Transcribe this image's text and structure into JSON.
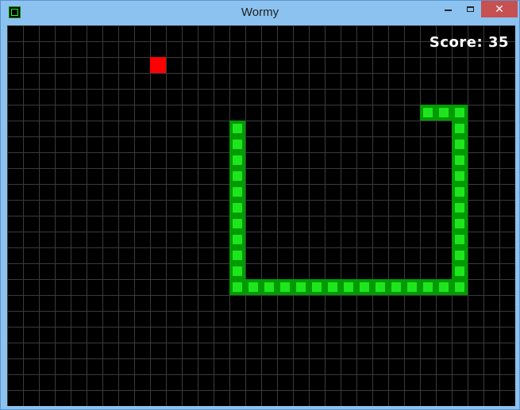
{
  "window": {
    "title": "Wormy",
    "icon": "wormy-app-icon",
    "controls": {
      "minimize": "minimize-icon",
      "maximize": "maximize-icon",
      "close_label": "✕"
    }
  },
  "game": {
    "score_text": "Score: 35",
    "grid": {
      "cols": 32,
      "rows": 24
    },
    "apple": {
      "col": 9,
      "row": 2
    },
    "worm": [
      [
        26,
        5
      ],
      [
        27,
        5
      ],
      [
        28,
        5
      ],
      [
        28,
        6
      ],
      [
        28,
        7
      ],
      [
        28,
        8
      ],
      [
        28,
        9
      ],
      [
        28,
        10
      ],
      [
        28,
        11
      ],
      [
        28,
        12
      ],
      [
        28,
        13
      ],
      [
        28,
        14
      ],
      [
        28,
        15
      ],
      [
        28,
        16
      ],
      [
        27,
        16
      ],
      [
        26,
        16
      ],
      [
        25,
        16
      ],
      [
        24,
        16
      ],
      [
        23,
        16
      ],
      [
        22,
        16
      ],
      [
        21,
        16
      ],
      [
        20,
        16
      ],
      [
        19,
        16
      ],
      [
        18,
        16
      ],
      [
        17,
        16
      ],
      [
        16,
        16
      ],
      [
        15,
        16
      ],
      [
        14,
        16
      ],
      [
        14,
        15
      ],
      [
        14,
        14
      ],
      [
        14,
        13
      ],
      [
        14,
        12
      ],
      [
        14,
        11
      ],
      [
        14,
        10
      ],
      [
        14,
        9
      ],
      [
        14,
        8
      ],
      [
        14,
        7
      ],
      [
        14,
        6
      ]
    ],
    "colors": {
      "background": "#000000",
      "grid": "#3a3a3a",
      "worm_outer": "#009b00",
      "worm_inner": "#1ee61e",
      "apple": "#ff0000",
      "score": "#ffffff"
    }
  }
}
